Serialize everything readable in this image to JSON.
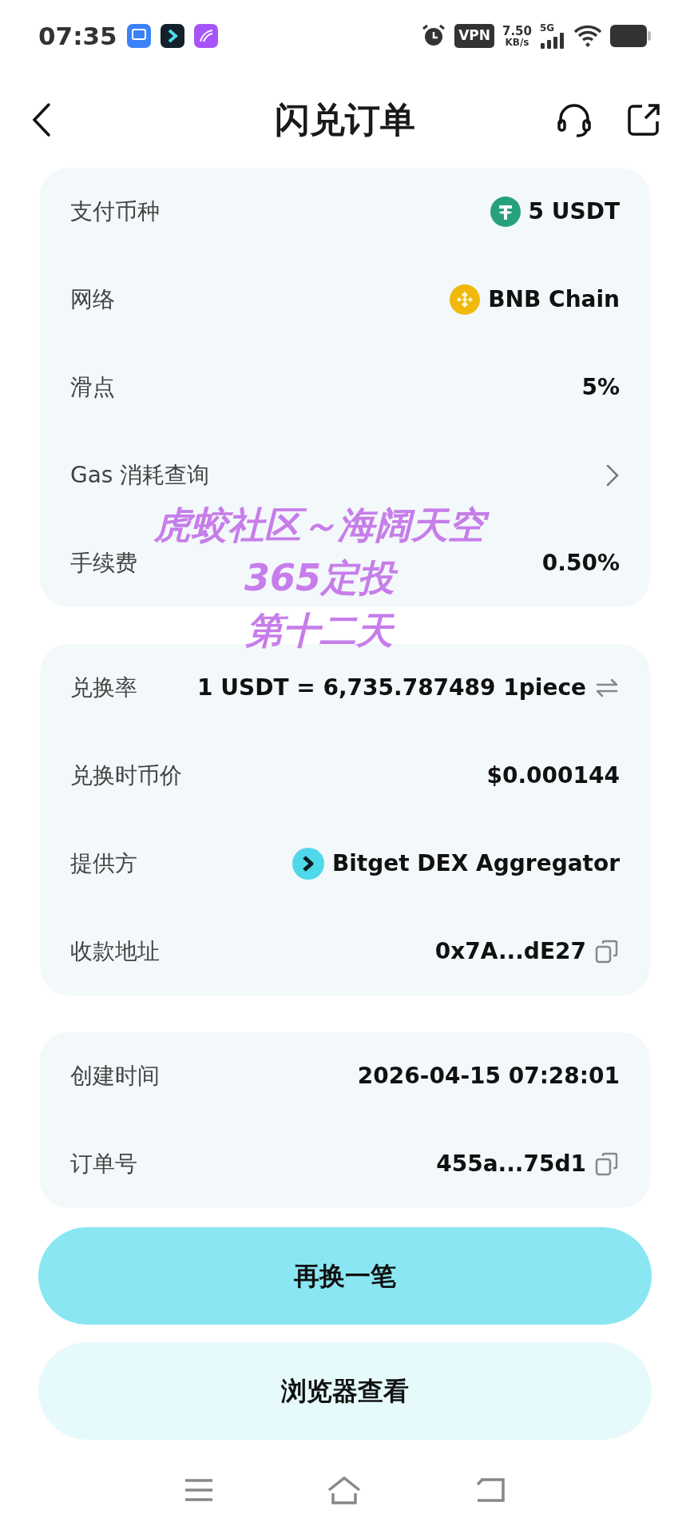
{
  "status_bar": {
    "time": "07:35",
    "vpn": "VPN",
    "speed": "7.50",
    "speed_unit": "KB/s",
    "network": "5G"
  },
  "header": {
    "title": "闪兑订单"
  },
  "cards": [
    {
      "rows": [
        {
          "label": "支付币种",
          "value": "5 USDT",
          "value_icon": {
            "kind": "tether"
          }
        },
        {
          "label": "网络",
          "value": "BNB Chain",
          "value_icon": {
            "kind": "bnb"
          }
        },
        {
          "label": "滑点",
          "value": "5%"
        },
        {
          "label": "Gas 消耗查询",
          "action": {
            "kind": "chevron"
          }
        },
        {
          "label": "手续费",
          "value": "0.50%"
        }
      ]
    },
    {
      "rows": [
        {
          "label": "兑换率",
          "value": "1 USDT = 6,735.787489 1piece",
          "action": {
            "kind": "swap"
          }
        },
        {
          "label": "兑换时币价",
          "value": "$0.000144"
        },
        {
          "label": "提供方",
          "value": "Bitget DEX Aggregator",
          "value_icon": {
            "kind": "bitget"
          }
        },
        {
          "label": "收款地址",
          "value": "0x7A...dE27",
          "action": {
            "kind": "copy"
          }
        }
      ]
    },
    {
      "rows": [
        {
          "label": "创建时间",
          "value": "2026-04-15 07:28:01"
        },
        {
          "label": "订单号",
          "value": "455a...75d1",
          "action": {
            "kind": "copy"
          }
        }
      ]
    }
  ],
  "buttons": [
    {
      "label": "再换一笔",
      "kind": "primary"
    },
    {
      "label": "浏览器查看",
      "kind": "secondary"
    }
  ],
  "caption": [
    "虎蛟社区～海阔天空",
    "365定投",
    "第十二天"
  ]
}
